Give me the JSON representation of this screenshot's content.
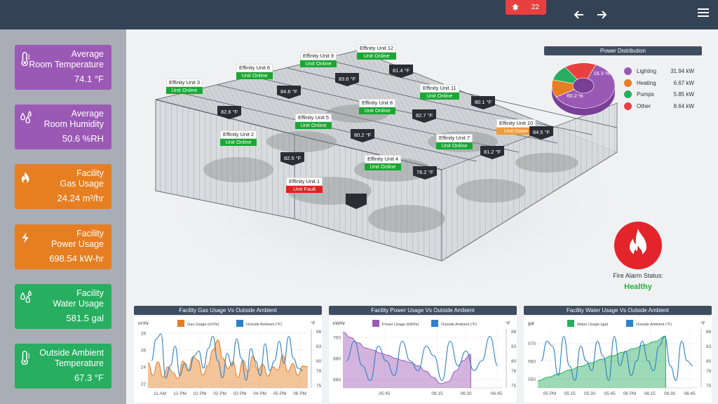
{
  "header": {
    "alarm_count": "22"
  },
  "cards": [
    {
      "label1": "Average",
      "label2": "Room Temperature",
      "value": "74.1 °F",
      "icon": "thermometer-icon",
      "color": "#9b59b6"
    },
    {
      "label1": "Average",
      "label2": "Room Humidity",
      "value": "50.6 %RH",
      "icon": "droplets-icon",
      "color": "#9b59b6"
    },
    {
      "label1": "Facility",
      "label2": "Gas Usage",
      "value": "24.24 m³/hr",
      "icon": "flame-icon",
      "color": "#e67e22"
    },
    {
      "label1": "Facility",
      "label2": "Power Usage",
      "value": "698.54 kW-hr",
      "icon": "bolt-icon",
      "color": "#e67e22"
    },
    {
      "label1": "Facility",
      "label2": "Water Usage",
      "value": "581.5 gal",
      "icon": "droplets-icon",
      "color": "#27ae60"
    },
    {
      "label1": "Outside Ambient",
      "label2": "Temperature",
      "value": "67.3 °F",
      "icon": "thermometer-icon",
      "color": "#27ae60"
    }
  ],
  "units": [
    {
      "name": "Effinity Unit 1",
      "status": "Unit Fault",
      "state": "fault"
    },
    {
      "name": "Effinity Unit 2",
      "status": "Unit Online",
      "state": "on"
    },
    {
      "name": "Effinity Unit 3",
      "status": "Unit Online",
      "state": "on"
    },
    {
      "name": "Effinity Unit 4",
      "status": "Unit Online",
      "state": "on"
    },
    {
      "name": "Effinity Unit 5",
      "status": "Unit Online",
      "state": "on"
    },
    {
      "name": "Effinity Unit 6",
      "status": "Unit Online",
      "state": "on"
    },
    {
      "name": "Effinity Unit 7",
      "status": "Unit Online",
      "state": "on"
    },
    {
      "name": "Effinity Unit 8",
      "status": "Unit Online",
      "state": "on"
    },
    {
      "name": "Effinity Unit 9",
      "status": "Unit Online",
      "state": "on"
    },
    {
      "name": "Effinity Unit 10",
      "status": "Unit Down",
      "state": "down"
    },
    {
      "name": "Effinity Unit 11",
      "status": "Unit Online",
      "state": "on"
    },
    {
      "name": "Effinity Unit 12",
      "status": "Unit Online",
      "state": "on"
    }
  ],
  "temps": [
    "82.6 °F",
    "84.6 °F",
    "83.6 °F",
    "81.4 °F",
    "80.1 °F",
    "82.7 °F",
    "80.2 °F",
    "82.5 °F",
    "78.2 °F",
    "81.2 °F",
    "84.5 °F",
    "",
    ""
  ],
  "power_distribution": {
    "title": "Power Distribution",
    "items": [
      {
        "name": "Lighting",
        "value": "31.94 kW",
        "pct": "60.2 %",
        "share": 60.2,
        "color": "#9b59b6"
      },
      {
        "name": "Heating",
        "value": "6.67 kW",
        "pct": "12.6 %",
        "share": 12.6,
        "color": "#e67e22"
      },
      {
        "name": "Pumps",
        "value": "5.85 kW",
        "pct": "11 %",
        "share": 11,
        "color": "#27ae60"
      },
      {
        "name": "Other",
        "value": "8.64 kW",
        "pct": "16.3 %",
        "share": 16.3,
        "color": "#e8403f"
      }
    ]
  },
  "fire": {
    "label": "Fire Alarm Status:",
    "status": "Healthy"
  },
  "chart_data": [
    {
      "type": "area",
      "title": "Facility Gas Usage Vs Outside Ambient",
      "ylabel_left": "m³/hr",
      "ylabel_right": "°F",
      "yticks_left": [
        "28",
        "26",
        "24",
        "22"
      ],
      "yticks_right": [
        "86",
        "83",
        "80",
        "78",
        "75"
      ],
      "xticks": [
        "11 AM",
        "12 PM",
        "01 PM",
        "02 PM",
        "03 PM",
        "04 PM",
        "05 PM",
        "06 PM"
      ],
      "ylim_left": [
        21.5,
        28.5
      ],
      "ylim_right": [
        74.5,
        86.5
      ],
      "series": [
        {
          "name": "Gas Usage (m³/hr)",
          "color": "#e67e22",
          "values": [
            24.5,
            23.0,
            24.6,
            22.8,
            24.0,
            23.3,
            22.6,
            24.7,
            23.5,
            25.2,
            24.8,
            23.0,
            24.2,
            26.0,
            27.2,
            25.0,
            23.8,
            24.6,
            22.7,
            24.8,
            23.4,
            25.3,
            23.6,
            24.3,
            22.9,
            24.0,
            23.6,
            25.4,
            23.4,
            24.4,
            23.0,
            24.1,
            24.0
          ]
        },
        {
          "name": "Outside Ambient (°F)",
          "color": "#2f80c7",
          "values": [
            80.0,
            84.5,
            85.5,
            76.5,
            79.0,
            83.0,
            77.0,
            79.5,
            78.0,
            81.0,
            82.0,
            78.5,
            82.5,
            85.0,
            80.0,
            76.5,
            81.5,
            79.0,
            84.5,
            80.5,
            76.0,
            82.5,
            80.0,
            77.0,
            83.5,
            78.0,
            80.0,
            84.0,
            79.5,
            85.0,
            80.5,
            78.5,
            78.0
          ]
        }
      ]
    },
    {
      "type": "area",
      "title": "Facility Power Usage Vs Outside Ambient",
      "ylabel_left": "kW/hr",
      "ylabel_right": "°F",
      "yticks_left": [
        "700",
        "680",
        "660"
      ],
      "yticks_right": [
        "86",
        "83",
        "80",
        "78",
        "75"
      ],
      "xticks": [
        "05:45",
        "06:15",
        "06:30",
        "06:45"
      ],
      "xtick_positions": [
        0.26,
        0.59,
        0.77,
        0.96
      ],
      "ylim_left": [
        652,
        708
      ],
      "ylim_right": [
        74.5,
        86.5
      ],
      "series": [
        {
          "name": "Power Usage (kW/hr)",
          "color": "#9b59b6",
          "values": [
            705,
            700,
            695,
            690,
            688,
            685,
            683,
            680,
            678,
            676,
            673,
            668,
            662,
            656,
            658,
            668,
            678,
            684
          ]
        },
        {
          "name": "Outside Ambient (°F)",
          "color": "#2f80c7",
          "values": [
            80,
            84,
            79,
            76,
            83,
            80,
            77,
            84,
            80,
            78,
            83,
            81,
            76,
            84,
            79,
            82,
            78,
            80,
            85,
            79
          ]
        }
      ]
    },
    {
      "type": "area",
      "title": "Facility Water Usage Vs Outside Ambient",
      "ylabel_left": "gal",
      "ylabel_right": "°F",
      "yticks_left": [
        "570",
        "560",
        "550"
      ],
      "yticks_right": [
        "86",
        "83",
        "80",
        "78",
        "75"
      ],
      "xticks": [
        "05 PM",
        "05:15",
        "05:30",
        "05:45",
        "06 PM",
        "06:15",
        "06:30",
        "06:45"
      ],
      "ylim_left": [
        545,
        578
      ],
      "ylim_right": [
        74.5,
        86.5
      ],
      "series": [
        {
          "name": "Water Usage (gal)",
          "color": "#27ae60",
          "values": [
            549,
            551,
            553,
            555,
            557,
            559,
            561,
            563,
            565,
            567,
            569,
            571,
            574
          ]
        },
        {
          "name": "Outside Ambient (°F)",
          "color": "#2f80c7",
          "values": [
            80,
            84,
            83,
            77,
            85,
            79,
            76,
            83,
            80,
            78,
            84,
            81,
            76,
            85,
            79,
            82,
            77,
            80,
            84,
            80,
            78,
            83,
            85,
            79,
            76,
            84,
            80,
            79
          ]
        }
      ]
    }
  ]
}
